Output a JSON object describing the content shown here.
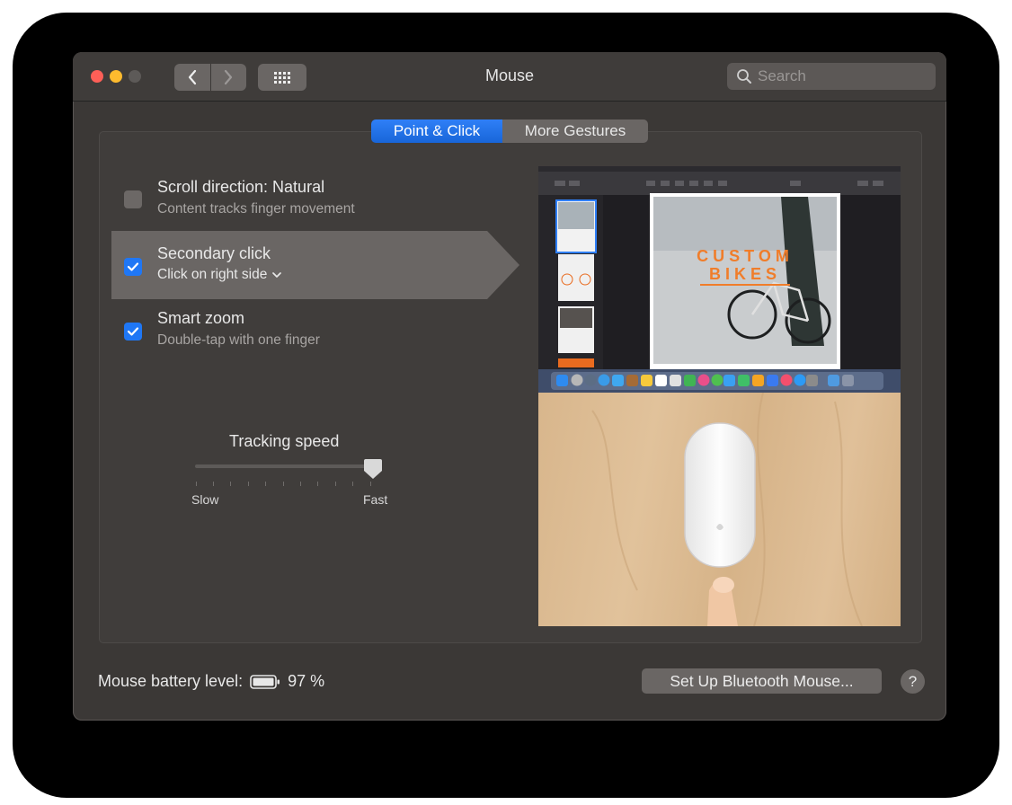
{
  "window": {
    "title": "Mouse",
    "search_placeholder": "Search"
  },
  "tabs": [
    {
      "label": "Point & Click",
      "active": true
    },
    {
      "label": "More Gestures",
      "active": false
    }
  ],
  "options": [
    {
      "title": "Scroll direction: Natural",
      "subtitle": "Content tracks finger movement",
      "checked": false
    },
    {
      "title": "Secondary click",
      "subtitle": "Click on right side",
      "checked": true
    },
    {
      "title": "Smart zoom",
      "subtitle": "Double-tap with one finger",
      "checked": true
    }
  ],
  "tracking": {
    "title": "Tracking speed",
    "min_label": "Slow",
    "max_label": "Fast",
    "level": 1.0
  },
  "preview": {
    "headline_1": "CUSTOM",
    "headline_2": "BIKES"
  },
  "battery": {
    "label": "Mouse battery level:",
    "value": "97 %"
  },
  "buttons": {
    "bluetooth": "Set Up Bluetooth Mouse...",
    "help": "?"
  },
  "colors": {
    "accent": "#1f77f5",
    "window_bg": "#3b3836"
  }
}
